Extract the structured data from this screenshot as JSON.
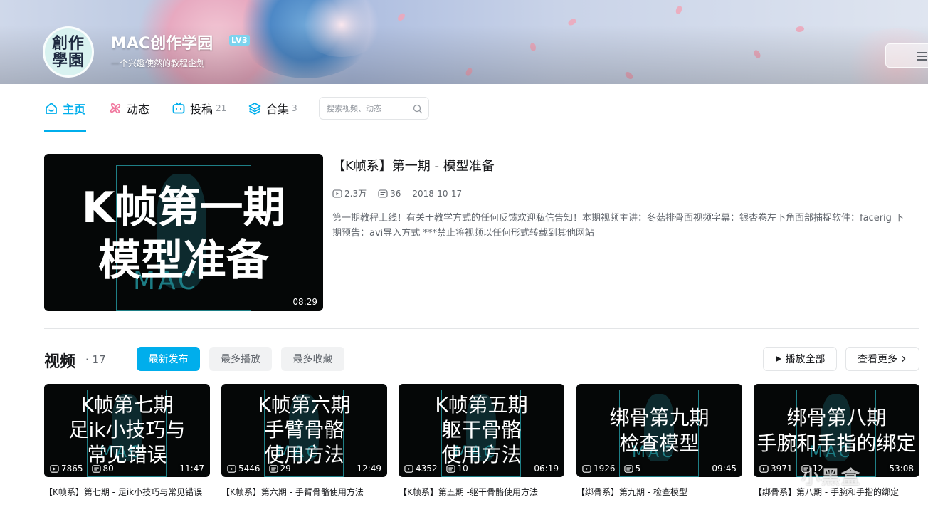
{
  "header": {
    "avatar_text": [
      "創作",
      "學園"
    ],
    "username": "MAC创作学园",
    "level_badge": "LV3",
    "signature": "一个兴趣使然的教程企划"
  },
  "nav": {
    "tabs": [
      {
        "label": "主页",
        "count": "",
        "icon": "home-icon"
      },
      {
        "label": "动态",
        "count": "",
        "icon": "pinwheel-icon"
      },
      {
        "label": "投稿",
        "count": "21",
        "icon": "tv-icon"
      },
      {
        "label": "合集",
        "count": "3",
        "icon": "layers-icon"
      }
    ],
    "search_placeholder": "搜索视频、动态"
  },
  "featured": {
    "cover_line1": "K帧第一期",
    "cover_line2": "模型准备",
    "cover_logo": "MAC",
    "duration": "08:29",
    "title": "【K帧系】第一期 - 模型准备",
    "views": "2.3万",
    "danmaku": "36",
    "date": "2018-10-17",
    "description": "第一期教程上线！有关于教学方式的任何反馈欢迎私信告知！本期视频主讲：冬菇排骨面视频字幕：银杏卷左下角面部捕捉软件：facerig 下期预告：avi导入方式 ***禁止将视频以任何形式转载到其他网站"
  },
  "videos": {
    "heading": "视频",
    "count": "17",
    "sort_options": [
      "最新发布",
      "最多播放",
      "最多收藏"
    ],
    "play_all": "播放全部",
    "view_more": "查看更多",
    "items": [
      {
        "cover": [
          "K帧第七期",
          "足ik小技巧与",
          "常见错误"
        ],
        "views": "7865",
        "danmaku": "80",
        "duration": "11:47",
        "title": "【K帧系】第七期 - 足ik小技巧与常见错误"
      },
      {
        "cover": [
          "K帧第六期",
          "手臂骨骼",
          "使用方法"
        ],
        "views": "5446",
        "danmaku": "29",
        "duration": "12:49",
        "title": "【K帧系】第六期 - 手臂骨骼使用方法"
      },
      {
        "cover": [
          "K帧第五期",
          "躯干骨骼",
          "使用方法"
        ],
        "views": "4352",
        "danmaku": "10",
        "duration": "06:19",
        "title": "【K帧系】第五期 -躯干骨骼使用方法"
      },
      {
        "cover": [
          "绑骨第九期",
          "检查模型"
        ],
        "views": "1926",
        "danmaku": "5",
        "duration": "09:45",
        "title": "【绑骨系】第九期 - 检查模型"
      },
      {
        "cover": [
          "绑骨第八期",
          "手腕和手指的绑定"
        ],
        "views": "3971",
        "danmaku": "12",
        "duration": "53:08",
        "title": "【绑骨系】第八期 - 手腕和手指的绑定"
      }
    ]
  },
  "watermark": "小黑盒",
  "colors": {
    "accent": "#00aeec",
    "text": "#18191c",
    "muted": "#61666d"
  }
}
